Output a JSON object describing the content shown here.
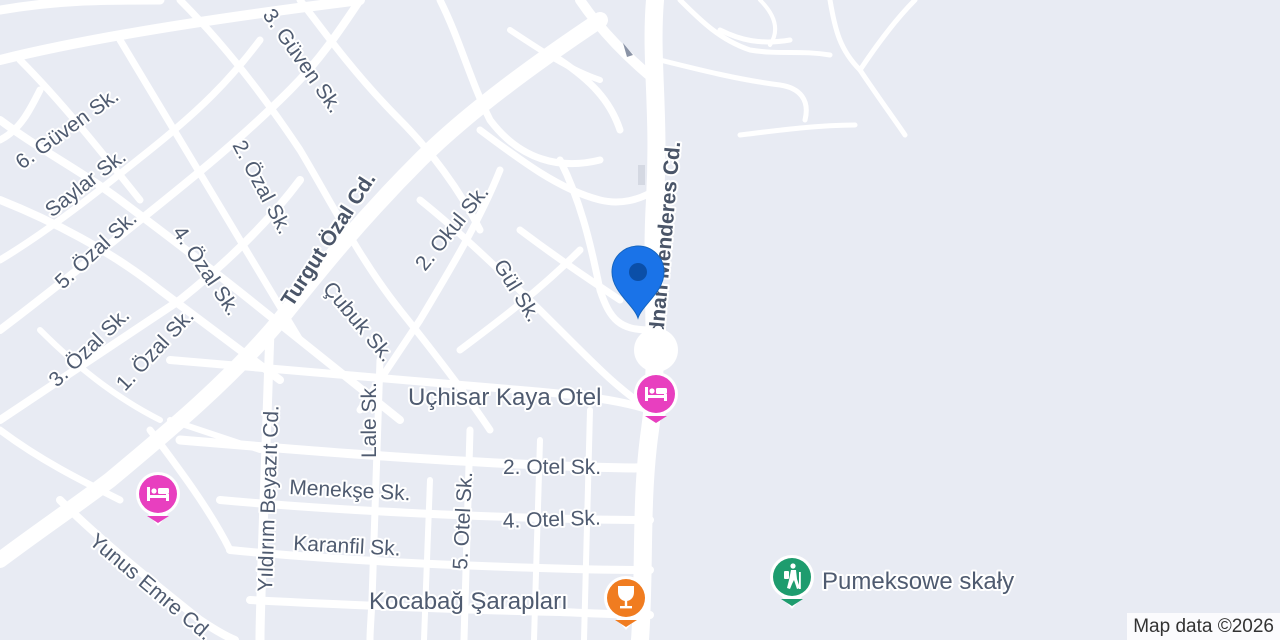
{
  "map": {
    "colors": {
      "background": "#e8ebf3",
      "road": "#ffffff",
      "label": "#4f5b70",
      "hotel": "#e83fbf",
      "restaurant": "#f07c20",
      "park": "#1e9c6e",
      "location_pin": "#1a73e8"
    },
    "streets": {
      "guven3": "3. Güven Sk.",
      "guven6": "6. Güven Sk.",
      "saylar": "Saylar Sk.",
      "ozal5": "5. Özal Sk.",
      "ozal2": "2. Özal Sk.",
      "ozal4": "4. Özal Sk.",
      "ozal3": "3. Özal Sk.",
      "ozal1": "1. Özal Sk.",
      "turgut": "Turgut Özal Cd.",
      "okul2": "2. Okul Sk.",
      "gul": "Gül Sk.",
      "cubuk": "Çubuk Sk.",
      "adnan": "Adnan Menderes Cd.",
      "lale": "Lale Sk.",
      "yildirim": "Yıldırım Beyazıt Cd.",
      "otel2": "2. Otel Sk.",
      "otel4": "4. Otel Sk.",
      "otel5": "5. Otel Sk.",
      "menekse": "Menekşe Sk.",
      "karanfil": "Karanfil Sk.",
      "yunus": "Yunus Emre Cd."
    },
    "pois": {
      "hotel1": {
        "name": "Uçhisar Kaya Otel",
        "icon": "hotel-icon"
      },
      "hotel2": {
        "icon": "hotel-icon"
      },
      "winery": {
        "name": "Kocabağ Şarapları",
        "icon": "wine-glass-icon"
      },
      "rocks": {
        "name": "Pumeksowe skały",
        "icon": "hiking-icon"
      }
    },
    "location_marker": {
      "icon": "location-pin-icon"
    },
    "attribution": "Map data ©2026"
  }
}
